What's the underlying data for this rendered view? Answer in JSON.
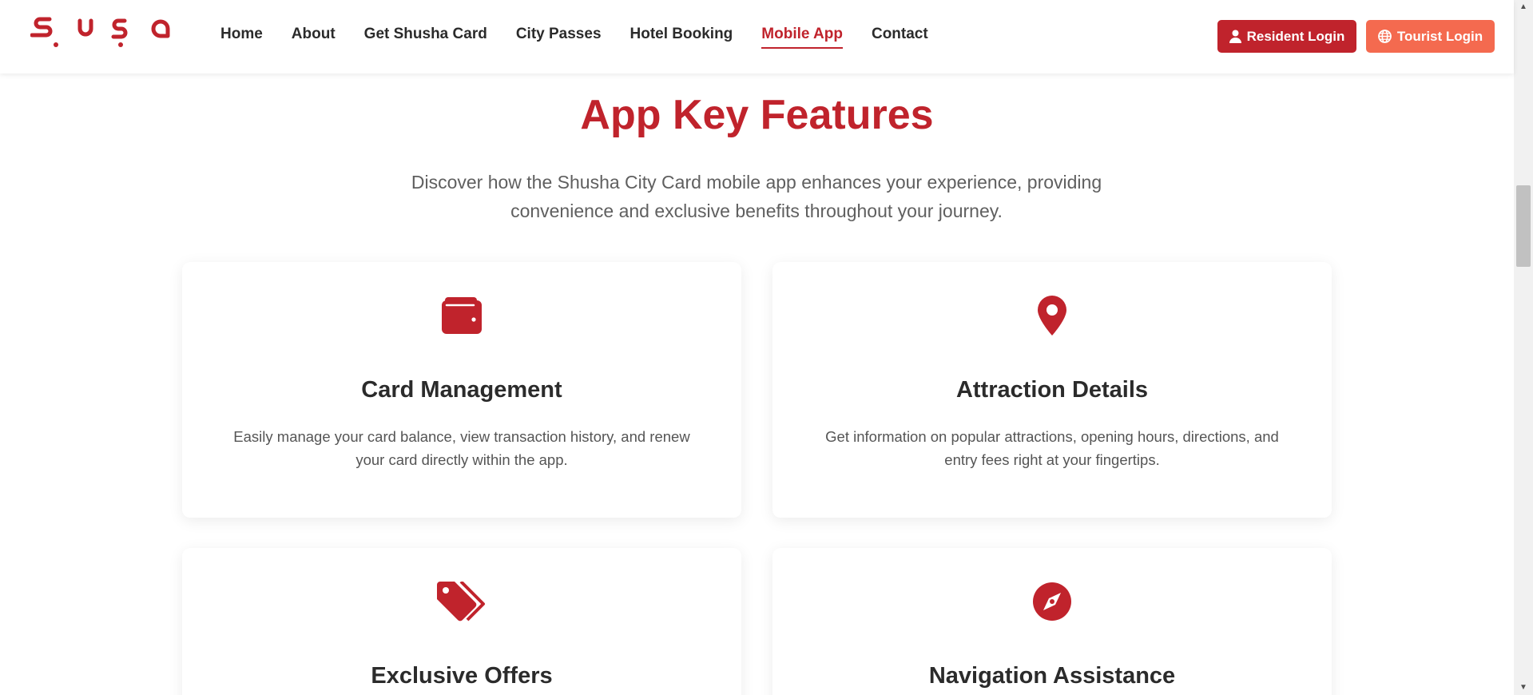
{
  "brand": {
    "logo_text": "Şuşa",
    "primary_color": "#c0232c",
    "accent_color": "#f46a4f"
  },
  "nav": {
    "items": [
      {
        "label": "Home",
        "active": false
      },
      {
        "label": "About",
        "active": false
      },
      {
        "label": "Get Shusha Card",
        "active": false
      },
      {
        "label": "City Passes",
        "active": false
      },
      {
        "label": "Hotel Booking",
        "active": false
      },
      {
        "label": "Mobile App",
        "active": true
      },
      {
        "label": "Contact",
        "active": false
      }
    ]
  },
  "auth": {
    "resident_label": "Resident Login",
    "resident_icon": "user-icon",
    "tourist_label": "Tourist Login",
    "tourist_icon": "globe-icon"
  },
  "section": {
    "title": "App Key Features",
    "subtitle": "Discover how the Shusha City Card mobile app enhances your experience, providing convenience and exclusive benefits throughout your journey."
  },
  "features": [
    {
      "icon": "wallet-icon",
      "title": "Card Management",
      "description": "Easily manage your card balance, view transaction history, and renew your card directly within the app."
    },
    {
      "icon": "map-pin-icon",
      "title": "Attraction Details",
      "description": "Get information on popular attractions, opening hours, directions, and entry fees right at your fingertips."
    },
    {
      "icon": "tags-icon",
      "title": "Exclusive Offers",
      "description": ""
    },
    {
      "icon": "compass-icon",
      "title": "Navigation Assistance",
      "description": ""
    }
  ]
}
